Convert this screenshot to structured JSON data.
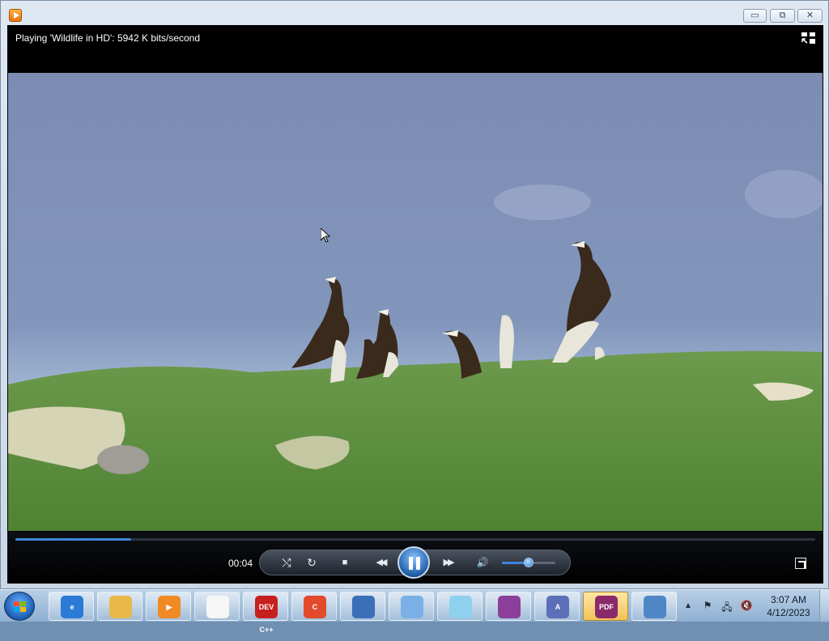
{
  "window": {
    "status_text": "Playing 'Wildlife in HD': 5942 K bits/second",
    "controls": {
      "minimize": "▭",
      "maximize": "⧉",
      "close": "✕"
    }
  },
  "player": {
    "elapsed_time": "00:04",
    "seek_progress": 0.145,
    "volume_level": 0.5,
    "buttons": {
      "shuffle": "⤭",
      "repeat": "↻",
      "stop": "■",
      "previous": "◀◀",
      "next": "▶▶",
      "mute": "🔊"
    }
  },
  "taskbar": {
    "items": [
      {
        "name": "internet-explorer",
        "glyph": "e",
        "color": "#2a7ad6"
      },
      {
        "name": "file-explorer",
        "glyph": "",
        "color": "#e8b94a"
      },
      {
        "name": "windows-media-player",
        "glyph": "▶",
        "color": "#f08a24",
        "active": false
      },
      {
        "name": "keepass",
        "glyph": "",
        "color": "#f6f6f6"
      },
      {
        "name": "dev-cpp",
        "glyph": "DEV C++",
        "color": "#c6201e"
      },
      {
        "name": "ccleaner",
        "glyph": "C",
        "color": "#e24a2b"
      },
      {
        "name": "remote-desktop",
        "glyph": "",
        "color": "#3b6fb8"
      },
      {
        "name": "paper-plane-app",
        "glyph": "",
        "color": "#7ab0e6"
      },
      {
        "name": "notepad",
        "glyph": "",
        "color": "#8fd0ef"
      },
      {
        "name": "winrar",
        "glyph": "",
        "color": "#8c3f9a"
      },
      {
        "name": "text-editor",
        "glyph": "A",
        "color": "#5c6fb8"
      },
      {
        "name": "foxit-pdf",
        "glyph": "PDF",
        "color": "#8a2a6a",
        "active": true
      },
      {
        "name": "screen-capture",
        "glyph": "",
        "color": "#4f86c6"
      }
    ],
    "clock_time": "3:07 AM",
    "clock_date": "4/12/2023",
    "tray_chevron": "▲"
  }
}
